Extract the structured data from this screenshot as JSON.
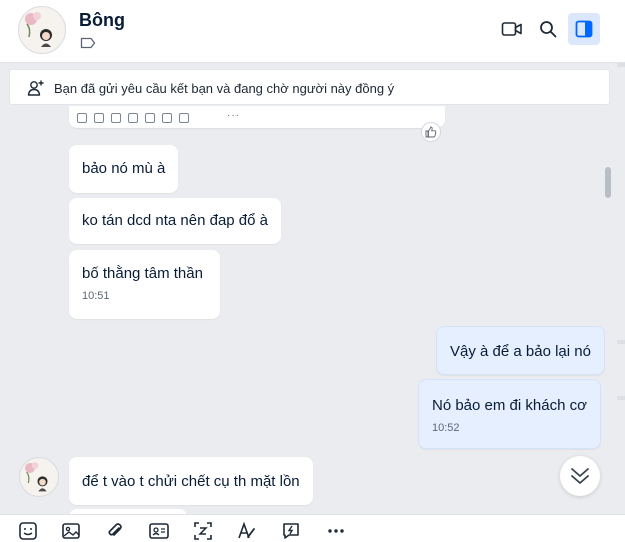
{
  "contact": {
    "name": "Bông",
    "avatar_icon": "flower-girl-avatar",
    "tag_icon": "label-tag-icon"
  },
  "header_actions": [
    {
      "name": "video-call",
      "icon": "video-camera-icon"
    },
    {
      "name": "search",
      "icon": "search-icon"
    },
    {
      "name": "toggle-info-panel",
      "icon": "side-panel-icon",
      "active": true
    }
  ],
  "banner": {
    "icon": "person-add-icon",
    "text": "Bạn đã gửi yêu cầu kết bạn và đang chờ người này đồng ý"
  },
  "messages": {
    "m1": {
      "text": "bảo nó mù à"
    },
    "m2": {
      "text": "ko tán dcd nta nên đap đổ à"
    },
    "m3": {
      "text": "bố thằng tâm thần",
      "time": "10:51"
    },
    "m4": {
      "text": "Vậy à để a bảo lại nó"
    },
    "m5": {
      "text": "Nó bảo em đi khách cơ",
      "time": "10:52"
    },
    "m6": {
      "text": "để t vào t chửi chết cụ th mặt lồn"
    }
  },
  "prev_toolbar": {
    "more": "···"
  },
  "toolbar": {
    "items": [
      "sticker-icon",
      "image-icon",
      "attachment-icon",
      "contact-card-icon",
      "screenshot-icon",
      "text-format-icon",
      "quick-message-icon",
      "more-icon"
    ],
    "more_label": "···"
  },
  "colors": {
    "accent": "#0068ff",
    "chat_background": "#ebecf0",
    "incoming_bubble": "#ffffff",
    "outgoing_bubble": "#e5efff"
  }
}
